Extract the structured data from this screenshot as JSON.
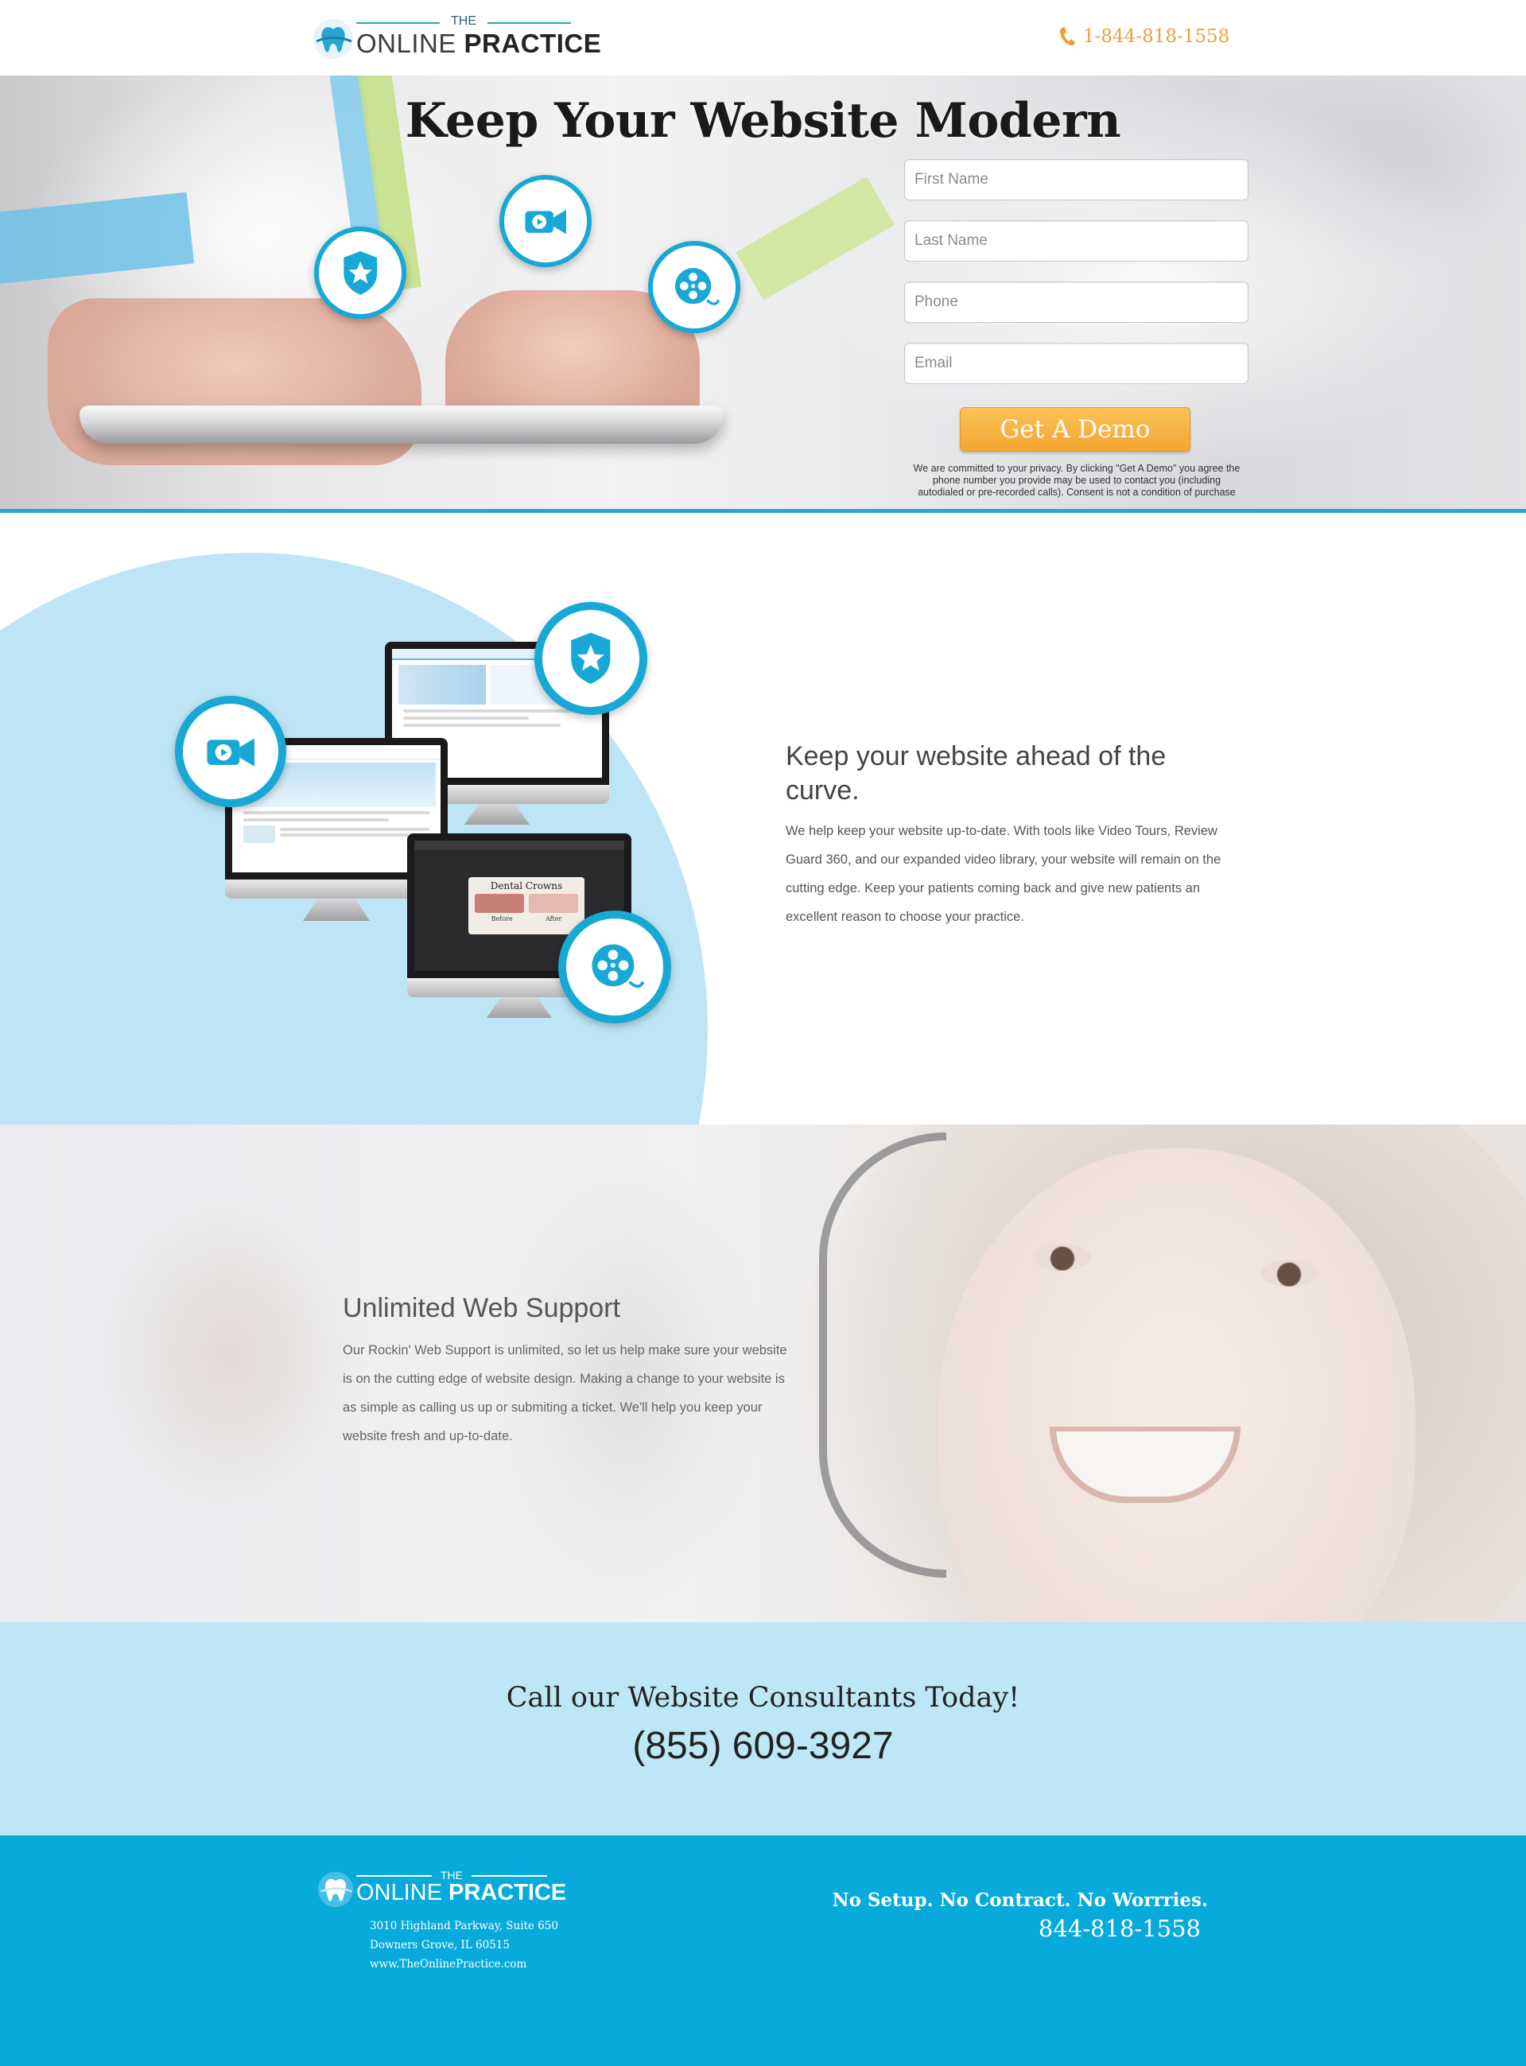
{
  "header": {
    "logo_the": "THE",
    "logo_online": "ONLINE ",
    "logo_practice": "PRACTICE",
    "phone": "1-844-818-1558",
    "phone_icon": "phone-icon",
    "phone_color": "#e8a23a"
  },
  "hero": {
    "title": "Keep Your Website Modern",
    "icons": [
      "star-shield-icon",
      "video-camera-icon",
      "film-reel-icon"
    ],
    "accent_color": "#17a8d6",
    "form": {
      "first_name_placeholder": "First Name",
      "last_name_placeholder": "Last Name",
      "phone_placeholder": "Phone",
      "email_placeholder": "Email",
      "submit_label": "Get A Demo",
      "privacy": "We are committed to your privacy. By clicking \"Get A Demo\" you agree the phone number you provide may be used to contact you (including autodialed or pre-recorded calls). Consent is not a condition of purchase"
    }
  },
  "feature": {
    "title": "Keep your website ahead of the curve.",
    "body": "We help keep your website up-to-date. With tools like Video Tours, Review Guard 360, and our expanded video library, your website will remain on the cutting edge. Keep your patients coming back and give new patients an excellent reason to choose your practice.",
    "monitor_caption": "Dental Crowns",
    "monitor_before": "Before",
    "monitor_after": "After",
    "background_color": "#bee5f5"
  },
  "support": {
    "title": "Unlimited Web Support",
    "body": "Our Rockin' Web Support is unlimited, so let us help make sure your website is on the cutting edge of website design. Making a change to your website is as simple as calling us up or submiting a ticket. We'll help you keep your website fresh and up-to-date."
  },
  "cta": {
    "heading": "Call our Website Consultants Today!",
    "phone": "(855) 609-3927",
    "background_color": "#bde6f6"
  },
  "footer": {
    "logo_the": "THE",
    "logo_online": "ONLINE ",
    "logo_practice": "PRACTICE",
    "address_line1": "3010 Highland Parkway, Suite 650",
    "address_line2": "Downers Grove, IL 60515",
    "website": "www.TheOnlinePractice.com",
    "tagline": "No Setup. No Contract. No Worrries.",
    "phone": "844-818-1558",
    "background_color": "#07aadb"
  }
}
